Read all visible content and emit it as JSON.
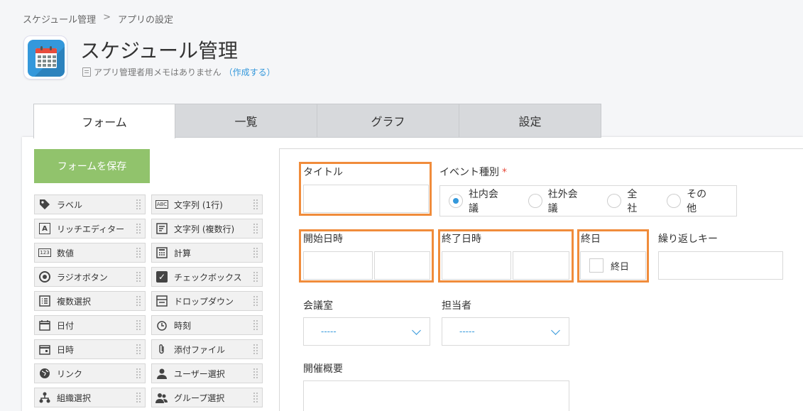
{
  "breadcrumb": {
    "app": "スケジュール管理",
    "separator": ">",
    "page": "アプリの設定"
  },
  "app": {
    "title": "スケジュール管理",
    "memo_text": "アプリ管理者用メモはありません",
    "memo_link": "（作成する）"
  },
  "tabs": [
    {
      "label": "フォーム",
      "active": true
    },
    {
      "label": "一覧",
      "active": false
    },
    {
      "label": "グラフ",
      "active": false
    },
    {
      "label": "設定",
      "active": false
    }
  ],
  "save_button": "フォームを保存",
  "palette": [
    {
      "label": "ラベル",
      "icon": "tag-icon"
    },
    {
      "label": "文字列 (1行)",
      "icon": "abc-icon"
    },
    {
      "label": "リッチエディター",
      "icon": "rich-text-icon"
    },
    {
      "label": "文字列 (複数行)",
      "icon": "multiline-text-icon"
    },
    {
      "label": "数値",
      "icon": "number-icon"
    },
    {
      "label": "計算",
      "icon": "calculator-icon"
    },
    {
      "label": "ラジオボタン",
      "icon": "radio-icon"
    },
    {
      "label": "チェックボックス",
      "icon": "checkbox-icon"
    },
    {
      "label": "複数選択",
      "icon": "multi-select-icon"
    },
    {
      "label": "ドロップダウン",
      "icon": "dropdown-icon"
    },
    {
      "label": "日付",
      "icon": "date-icon"
    },
    {
      "label": "時刻",
      "icon": "clock-icon"
    },
    {
      "label": "日時",
      "icon": "datetime-icon"
    },
    {
      "label": "添付ファイル",
      "icon": "paperclip-icon"
    },
    {
      "label": "リンク",
      "icon": "globe-icon"
    },
    {
      "label": "ユーザー選択",
      "icon": "user-icon"
    },
    {
      "label": "組織選択",
      "icon": "org-icon"
    },
    {
      "label": "グループ選択",
      "icon": "group-icon"
    }
  ],
  "form": {
    "title_label": "タイトル",
    "event_type_label": "イベント種別",
    "required_mark": "*",
    "event_options": [
      {
        "label": "社内会議",
        "selected": true
      },
      {
        "label": "社外会議",
        "selected": false
      },
      {
        "label": "全社",
        "selected": false
      },
      {
        "label": "その他",
        "selected": false
      }
    ],
    "start_label": "開始日時",
    "end_label": "終了日時",
    "allday_label": "終日",
    "allday_option": "終日",
    "repeat_label": "繰り返しキー",
    "room_label": "会議室",
    "room_value": "-----",
    "owner_label": "担当者",
    "owner_value": "-----",
    "summary_label": "開催概要"
  },
  "colors": {
    "accent": "#3498db",
    "save": "#91c36c",
    "highlight": "#f08c3b",
    "required": "#e74c3c"
  }
}
